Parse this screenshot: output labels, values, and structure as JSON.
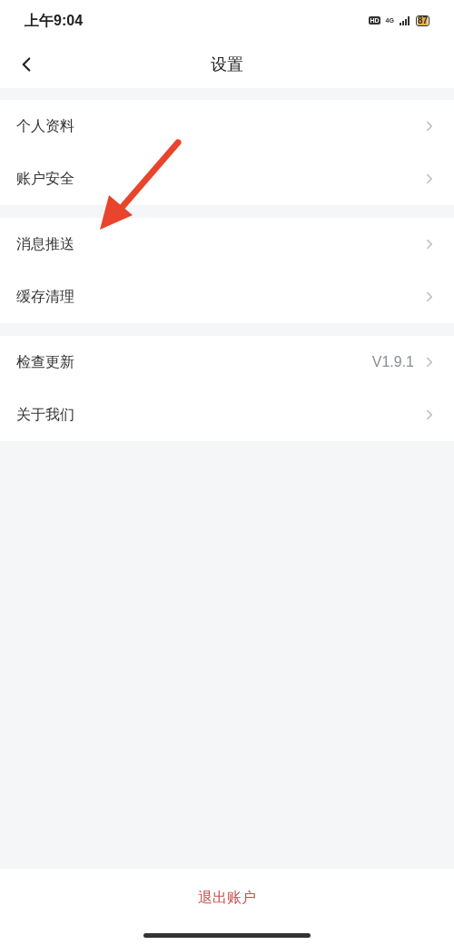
{
  "status_bar": {
    "time": "上午9:04",
    "hd": "HD",
    "network": "4G",
    "battery": "87"
  },
  "header": {
    "title": "设置"
  },
  "groups": [
    {
      "items": [
        {
          "label": "个人资料"
        },
        {
          "label": "账户安全"
        }
      ]
    },
    {
      "items": [
        {
          "label": "消息推送"
        },
        {
          "label": "缓存清理"
        }
      ]
    },
    {
      "items": [
        {
          "label": "检查更新",
          "value": "V1.9.1"
        },
        {
          "label": "关于我们"
        }
      ]
    }
  ],
  "logout": "退出账户"
}
